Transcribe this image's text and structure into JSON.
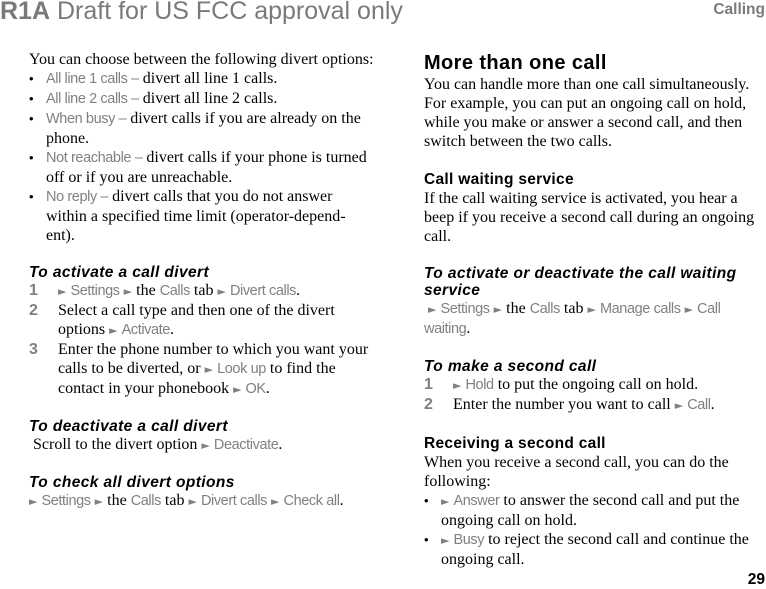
{
  "header": {
    "draft_code": "R1A",
    "draft_text": "Draft for US FCC approval only",
    "chapter": "Calling"
  },
  "footer": {
    "page_number": "29"
  },
  "colors": {
    "ui_text": "#808080",
    "header_gray": "#7a7a7a",
    "body_text": "#000000"
  },
  "icons": {
    "arrow": "►",
    "bullet": "•"
  },
  "left": {
    "intro": "You can choose between the following divert options:",
    "divert_options": [
      {
        "name": "All line 1 calls –",
        "desc": " divert all line 1 calls."
      },
      {
        "name": "All line 2 calls –",
        "desc": " divert all line 2 calls."
      },
      {
        "name": "When busy –",
        "desc": " divert calls if you are already on the phone."
      },
      {
        "name": "Not reachable –",
        "desc": " divert calls if your phone is turned off or if you are unreachable."
      },
      {
        "name": "No reply –",
        "desc": " divert calls that you do not answer within a specified time limit (operator-depend-ent)."
      }
    ],
    "activate": {
      "heading": "To activate a call divert",
      "step1": {
        "num": "1",
        "settings": "Settings",
        "the": " the ",
        "calls": "Calls",
        "tab": " tab ",
        "divert": "Divert calls",
        "end": "."
      },
      "step2": {
        "num": "2",
        "text": "Select a call type and then one of the divert options ",
        "activate": "Activate",
        "end": "."
      },
      "step3": {
        "num": "3",
        "text": "Enter the phone number to which you want your calls to be diverted, or ",
        "lookup": "Look up",
        "mid": " to find the contact in your phonebook ",
        "ok": "OK",
        "end": "."
      }
    },
    "deactivate": {
      "heading": "To deactivate a call divert",
      "text": "Scroll to the divert option ",
      "action": "Deactivate",
      "end": "."
    },
    "check": {
      "heading": "To check all divert options",
      "settings": "Settings",
      "the": " the ",
      "calls": "Calls",
      "tab": " tab ",
      "divert": "Divert calls",
      "checkall": "Check all",
      "end": "."
    }
  },
  "right": {
    "main_heading": "More than one call",
    "main_text": "You can handle more than one call simultaneously. For example, you can put an ongoing call on hold, while you make or answer a second call, and then switch between the two calls.",
    "waiting": {
      "heading": "Call waiting service",
      "text": "If the call waiting service is activated, you hear a beep if you receive a second call during an ongoing call."
    },
    "toggle_waiting": {
      "heading": "To activate or deactivate the call waiting service",
      "settings": "Settings",
      "the": " the ",
      "calls": "Calls",
      "tab": " tab ",
      "manage": "Manage calls",
      "callwaiting": "Call waiting",
      "end": "."
    },
    "second_call": {
      "heading": "To make a second call",
      "step1": {
        "num": "1",
        "hold": "Hold",
        "text": " to put the ongoing call on hold."
      },
      "step2": {
        "num": "2",
        "text": "Enter the number you want to call ",
        "call": "Call",
        "end": "."
      }
    },
    "receiving": {
      "heading": "Receiving a second call",
      "text": "When you receive a second call, you can do the following:",
      "options": [
        {
          "action": "Answer",
          "desc": " to answer the second call and put the ongoing call on hold."
        },
        {
          "action": "Busy",
          "desc": " to reject the second call and continue the ongoing call."
        }
      ]
    }
  }
}
